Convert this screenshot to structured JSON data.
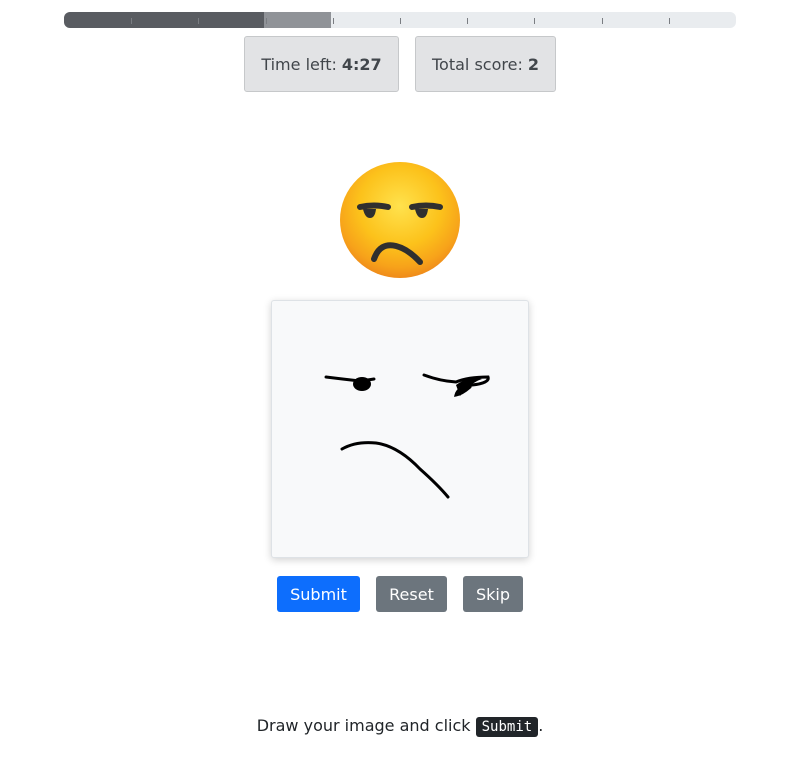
{
  "progress": {
    "completed_fraction": 0.2976,
    "current_fraction": 0.1,
    "segments": 10
  },
  "timer": {
    "label": "Time left:",
    "value": "4:27"
  },
  "score": {
    "label": "Total score:",
    "value": "2"
  },
  "target_emoji": {
    "icon": "unamused-face-emoji"
  },
  "drawing_canvas": {
    "content": "user sketch of unamused face"
  },
  "buttons": {
    "submit": "Submit",
    "reset": "Reset",
    "skip": "Skip"
  },
  "instructions": {
    "prefix": "Draw your image and click",
    "key": "Submit",
    "suffix": "."
  },
  "colors": {
    "primary": "#0d6efd",
    "secondary": "#6c757d",
    "progress_done": "#595c61",
    "progress_current": "#909398"
  }
}
